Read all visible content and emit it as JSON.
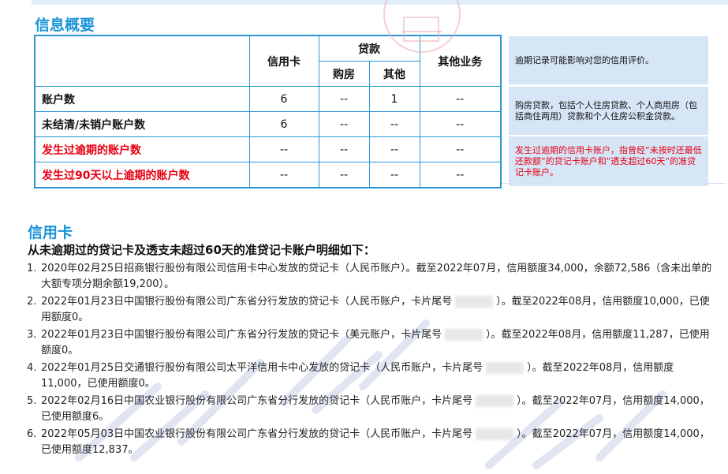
{
  "section1_title": "信息概要",
  "summary": {
    "header": {
      "credit_card": "信用卡",
      "loan": "贷款",
      "housing": "购房",
      "other": "其他",
      "other_business": "其他业务"
    },
    "rows": [
      {
        "label": "账户数",
        "red": false,
        "credit_card": "6",
        "housing": "--",
        "other": "1",
        "other_business": "--"
      },
      {
        "label": "未结清/未销户账户数",
        "red": false,
        "credit_card": "6",
        "housing": "--",
        "other": "--",
        "other_business": "--"
      },
      {
        "label": "发生过逾期的账户数",
        "red": true,
        "credit_card": "--",
        "housing": "--",
        "other": "--",
        "other_business": "--"
      },
      {
        "label": "发生过90天以上逾期的账户数",
        "red": true,
        "credit_card": "--",
        "housing": "--",
        "other": "--",
        "other_business": "--"
      }
    ]
  },
  "notes": [
    "逾期记录可能影响对您的信用评价。",
    "购房贷款，包括个人住房贷款、个人商用房（包括商住两用）贷款和个人住房公积金贷款。",
    "发生过逾期的信用卡账户，指曾经“未按时还最低还款额”的贷记卡账户和“透支超过60天”的准贷记卡账户。"
  ],
  "section2_title": "信用卡",
  "subheading": "从未逾期过的贷记卡及透支未超过60天的准贷记卡账户明细如下：",
  "card_items": [
    {
      "num": "1.",
      "before": "2020年02月25日招商银行股份有限公司信用卡中心发放的贷记卡（人民币账户）。截至2022年07月，信用额度34,000，余额72,586（含未出单的大额专项分期余额19,200）。",
      "masked": false,
      "after": ""
    },
    {
      "num": "2.",
      "before": "2022年01月23日中国银行股份有限公司广东省分行发放的贷记卡（人民币账户，卡片尾号",
      "masked": true,
      "after": "）。截至2022年08月，信用额度10,000，已使用额度0。"
    },
    {
      "num": "3.",
      "before": "2022年01月23日中国银行股份有限公司广东省分行发放的贷记卡（美元账户，卡片尾号",
      "masked": true,
      "after": "）。截至2022年08月，信用额度11,287，已使用额度0。"
    },
    {
      "num": "4.",
      "before": "2022年01月25日交通银行股份有限公司太平洋信用卡中心发放的贷记卡（人民币账户，卡片尾号",
      "masked": true,
      "after": "）。截至2022年08月，信用额度11,000，已使用额度0。"
    },
    {
      "num": "5.",
      "before": "2022年02月16日中国农业银行股份有限公司广东省分行发放的贷记卡（人民币账户，卡片尾号",
      "masked": true,
      "after": "）。截至2022年07月，信用额度14,000，已使用额度6。"
    },
    {
      "num": "6.",
      "before": "2022年05月03日中国农业银行股份有限公司广东省分行发放的贷记卡（人民币账户，卡片尾号",
      "masked": true,
      "after": "）。截至2022年07月，信用额度14,000，已使用额度12,837。"
    }
  ],
  "colors": {
    "accent": "#1a93d8",
    "warning": "#e60012",
    "note_bg": "#d6e6f7"
  }
}
